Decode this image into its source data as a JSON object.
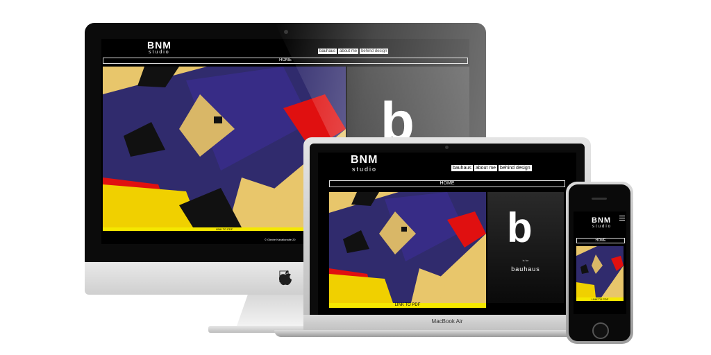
{
  "site": {
    "logo_main": "BNM",
    "logo_sub": "studio",
    "nav": [
      "bauhaus",
      "about me",
      "behind design"
    ],
    "home_label": "HOME",
    "pdf_label": "LINK TO PDF",
    "copyright": "© Giedre Kavaliunaite 20",
    "panel_small": "is for",
    "panel_word": "bauhaus",
    "panel_letter": "b"
  },
  "devices": {
    "laptop_label": "MacBook Air"
  },
  "icons": {
    "apple": "apple-logo-icon",
    "menu": "hamburger-menu-icon"
  },
  "colors": {
    "art_yellow": "#e8c66b",
    "art_blue": "#1c1a6e",
    "art_red": "#e01010",
    "pdf_yellow": "#f5e800"
  }
}
